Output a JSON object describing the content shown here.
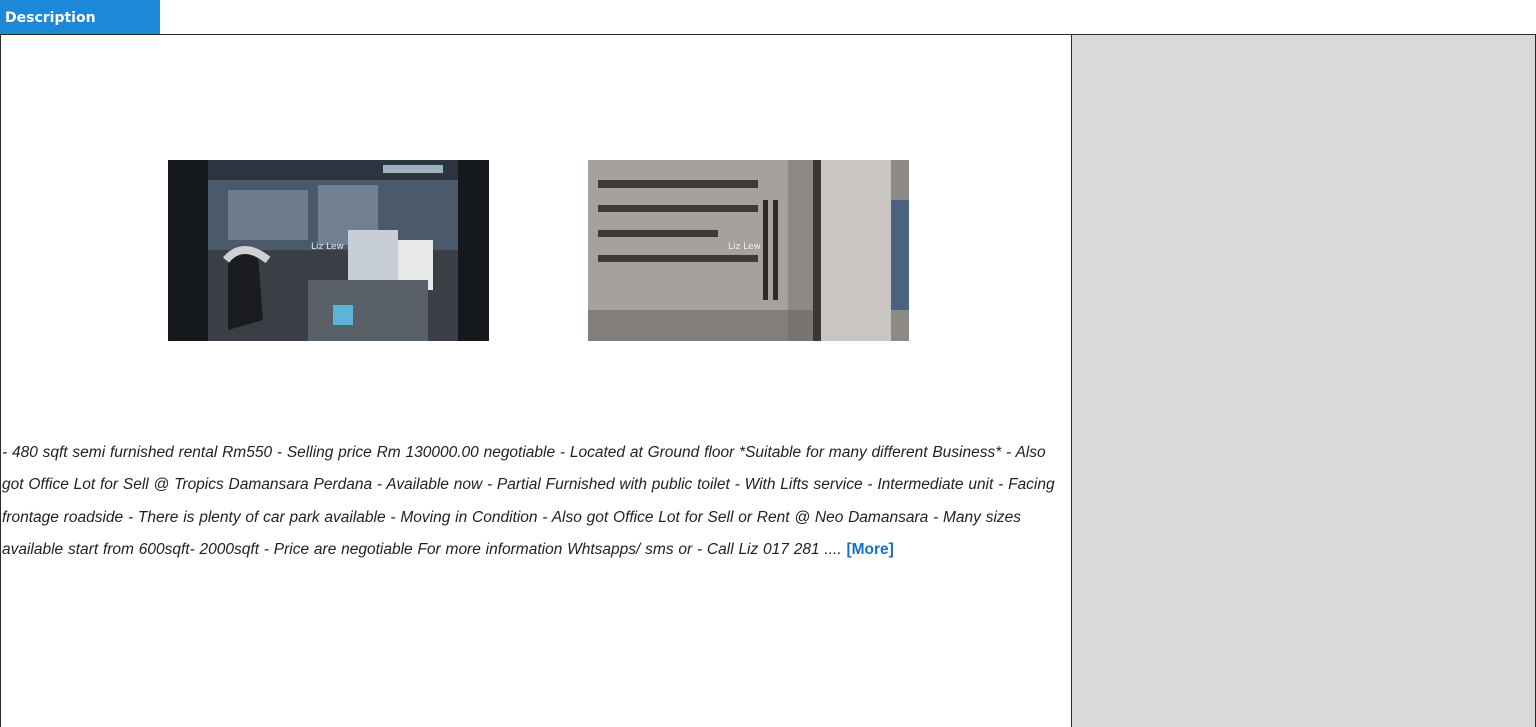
{
  "header": {
    "tab_label": "Description"
  },
  "photos": [
    {
      "watermark": "Liz Lew"
    },
    {
      "watermark": "Liz Lew"
    }
  ],
  "description": {
    "text": "- 480 sqft semi furnished rental Rm550  - Selling price Rm 130000.00 negotiable  - Located at Ground floor  *Suitable for many different Business*  - Also got Office Lot for Sell @ Tropics Damansara Perdana  - Available now  - Partial Furnished with public toilet  - With Lifts service  - Intermediate unit  - Facing frontage roadside  - There is plenty of car park available  - Moving in Condition   - Also got Office Lot for Sell or Rent @ Neo Damansara  - Many sizes available start from 600sqft- 2000sqft  - Price are negotiable  For more information Whtsapps/ sms or  - Call Liz 017 281 ....",
    "more_label": "[More]"
  },
  "colors": {
    "tab_bg": "#1e88d8",
    "link": "#1670c6",
    "side_panel": "#d9d9d9"
  }
}
